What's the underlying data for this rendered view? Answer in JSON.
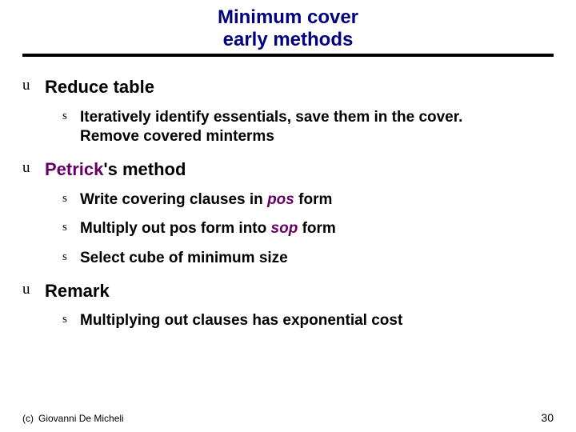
{
  "title": {
    "line1": "Minimum cover",
    "line2": "early methods"
  },
  "sections": {
    "reduce": {
      "bullet": "u",
      "heading": "Reduce table",
      "items": {
        "a": {
          "bullet": "s",
          "text": "Iteratively identify essentials, save them in the cover. Remove covered minterms"
        }
      }
    },
    "petrick": {
      "bullet": "u",
      "heading_pre": "Petrick",
      "heading_post": "'s method",
      "items": {
        "a": {
          "bullet": "s",
          "pre": "Write covering clauses in ",
          "em": "pos",
          "post": " form"
        },
        "b": {
          "bullet": "s",
          "pre": "Multiply out pos form into ",
          "em": "sop",
          "post": " form"
        },
        "c": {
          "bullet": "s",
          "text": "Select cube of minimum size"
        }
      }
    },
    "remark": {
      "bullet": "u",
      "heading": "Remark",
      "items": {
        "a": {
          "bullet": "s",
          "text": "Multiplying out clauses has exponential cost"
        }
      }
    }
  },
  "footer": {
    "copyright_mark": "(c)",
    "author": "Giovanni De Micheli",
    "page": "30"
  }
}
